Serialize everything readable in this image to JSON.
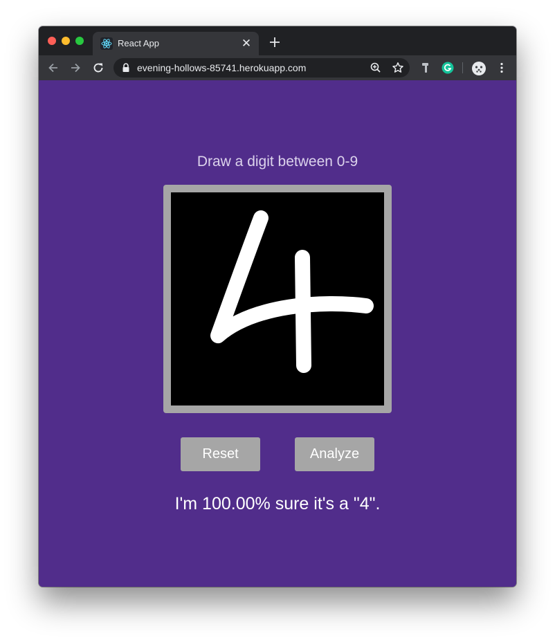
{
  "browser": {
    "tab_title": "React App",
    "url": "evening-hollows-85741.herokuapp.com"
  },
  "page": {
    "heading": "Draw a digit between 0-9",
    "reset_label": "Reset",
    "analyze_label": "Analyze",
    "result_text": "I'm 100.00% sure it's a \"4\"."
  },
  "colors": {
    "page_background": "#512d8b",
    "button": "#a6a6a6",
    "canvas_frame": "#a6a6a6",
    "canvas": "#000000",
    "stroke": "#ffffff"
  },
  "icons": {
    "tab": [
      "react-icon",
      "close-icon",
      "plus-icon"
    ],
    "toolbar": [
      "arrow-left-icon",
      "arrow-right-icon",
      "reload-icon",
      "lock-icon",
      "zoom-icon",
      "star-icon",
      "hammer-icon",
      "grammarly-icon",
      "profile-icon",
      "more-vert-icon"
    ]
  }
}
